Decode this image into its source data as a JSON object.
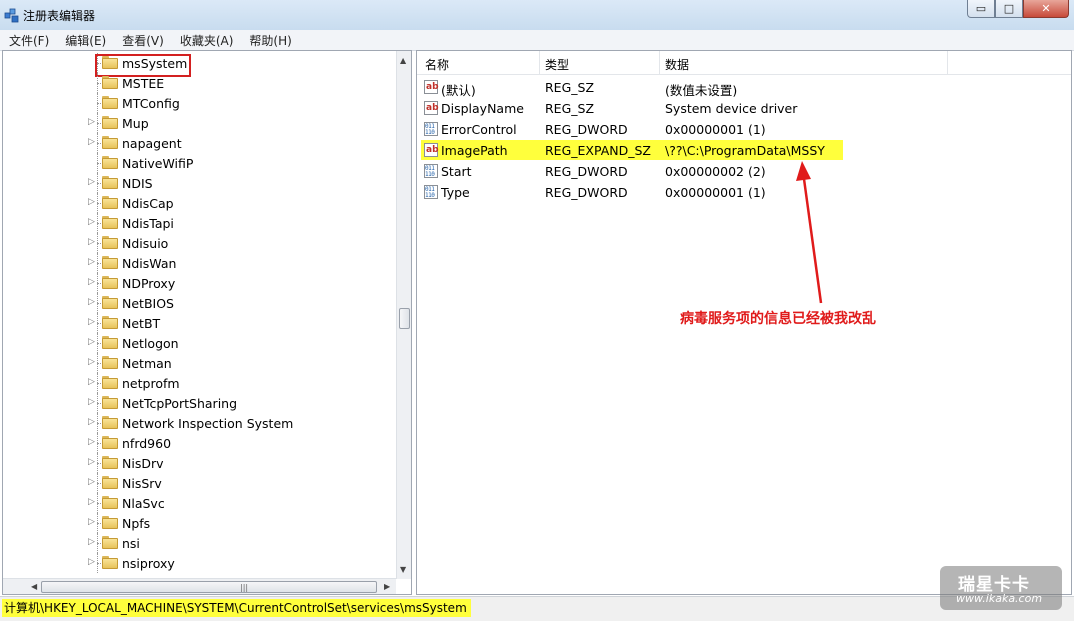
{
  "window": {
    "title": "注册表编辑器",
    "minimize": "▭",
    "maximize": "□",
    "close": "✕"
  },
  "menu": [
    "文件(F)",
    "编辑(E)",
    "查看(V)",
    "收藏夹(A)",
    "帮助(H)"
  ],
  "tree": {
    "items": [
      {
        "label": "msSystem",
        "expandable": false,
        "selected": true
      },
      {
        "label": "MSTEE",
        "expandable": false
      },
      {
        "label": "MTConfig",
        "expandable": false
      },
      {
        "label": "Mup",
        "expandable": true
      },
      {
        "label": "napagent",
        "expandable": true
      },
      {
        "label": "NativeWifiP",
        "expandable": false
      },
      {
        "label": "NDIS",
        "expandable": true
      },
      {
        "label": "NdisCap",
        "expandable": true
      },
      {
        "label": "NdisTapi",
        "expandable": true
      },
      {
        "label": "Ndisuio",
        "expandable": true
      },
      {
        "label": "NdisWan",
        "expandable": true
      },
      {
        "label": "NDProxy",
        "expandable": true
      },
      {
        "label": "NetBIOS",
        "expandable": true
      },
      {
        "label": "NetBT",
        "expandable": true
      },
      {
        "label": "Netlogon",
        "expandable": true
      },
      {
        "label": "Netman",
        "expandable": true
      },
      {
        "label": "netprofm",
        "expandable": true
      },
      {
        "label": "NetTcpPortSharing",
        "expandable": true
      },
      {
        "label": "Network Inspection System",
        "expandable": true
      },
      {
        "label": "nfrd960",
        "expandable": true
      },
      {
        "label": "NisDrv",
        "expandable": true
      },
      {
        "label": "NisSrv",
        "expandable": true
      },
      {
        "label": "NlaSvc",
        "expandable": true
      },
      {
        "label": "Npfs",
        "expandable": true
      },
      {
        "label": "nsi",
        "expandable": true
      },
      {
        "label": "nsiproxy",
        "expandable": true
      }
    ]
  },
  "list": {
    "headers": {
      "name": "名称",
      "type": "类型",
      "data": "数据"
    },
    "rows": [
      {
        "icon": "ab",
        "name": "(默认)",
        "type": "REG_SZ",
        "data": "(数值未设置)"
      },
      {
        "icon": "ab",
        "name": "DisplayName",
        "type": "REG_SZ",
        "data": "System device driver"
      },
      {
        "icon": "011",
        "name": "ErrorControl",
        "type": "REG_DWORD",
        "data": "0x00000001 (1)"
      },
      {
        "icon": "ab",
        "name": "ImagePath",
        "type": "REG_EXPAND_SZ",
        "data": "\\??\\C:\\ProgramData\\MSSY",
        "highlighted": true
      },
      {
        "icon": "011",
        "name": "Start",
        "type": "REG_DWORD",
        "data": "0x00000002 (2)"
      },
      {
        "icon": "011",
        "name": "Type",
        "type": "REG_DWORD",
        "data": "0x00000001 (1)"
      }
    ]
  },
  "annotation": "病毒服务项的信息已经被我改乱",
  "status_path": "计算机\\HKEY_LOCAL_MACHINE\\SYSTEM\\CurrentControlSet\\services\\msSystem",
  "watermark": {
    "name": "瑞星卡卡",
    "url": "www.ikaka.com"
  },
  "colors": {
    "highlight": "#ffff3c",
    "annotation": "#e01b1b"
  }
}
